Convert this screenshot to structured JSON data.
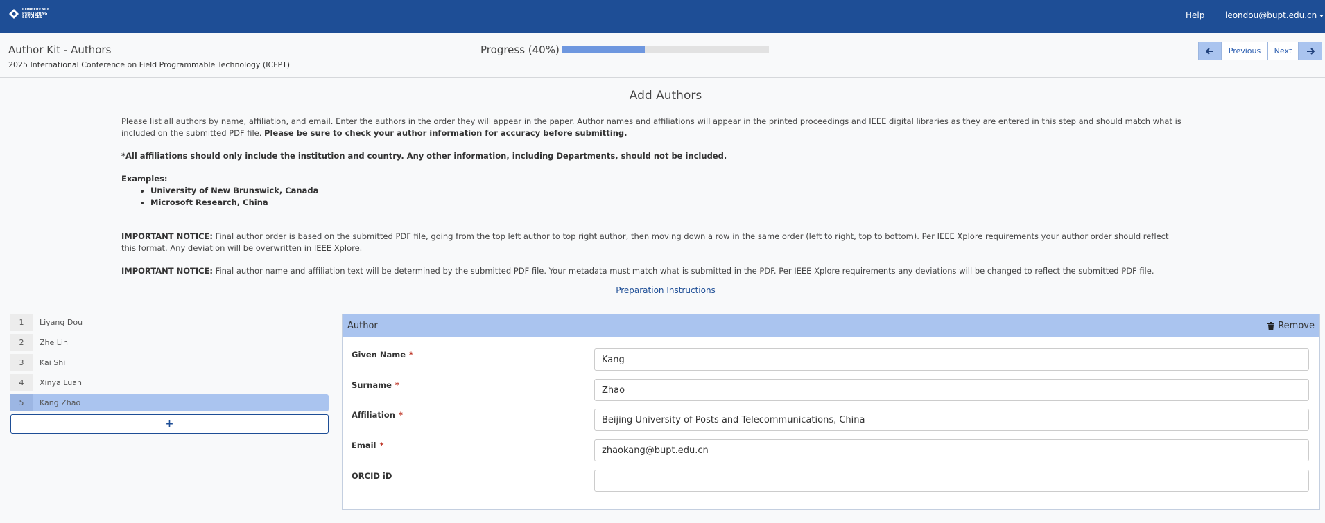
{
  "navbar": {
    "logo_lines": [
      "CONFERENCE",
      "PUBLISHING",
      "SERVICES"
    ],
    "help_label": "Help",
    "user_label": "leondou@bupt.edu.cn",
    "bg_color": "#1e4e96"
  },
  "subheader": {
    "kit_title": "Author Kit - Authors",
    "conference_name": "2025 International Conference on Field Programmable Technology (ICFPT)",
    "progress_label": "Progress (40%)",
    "progress_fraction": 0.4,
    "prev_label": "Previous",
    "next_label": "Next",
    "prev_icon": "arrow-left-icon",
    "next_icon": "arrow-right-icon"
  },
  "main": {
    "title": "Add Authors",
    "intro_text": "Please list all authors by name, affiliation, and email. Enter the authors in the order they will appear in the paper. Author names and affiliations will appear in the printed proceedings and IEEE digital libraries as they are entered in this step and should match what is included on the submitted PDF file.",
    "intro_bold": "Please be sure to check your author information for accuracy before submitting.",
    "affiliation_note": "*All affiliations should only include the institution and country. Any other information, including Departments, should not be included.",
    "examples_label": "Examples:",
    "examples": [
      "University of New Brunswick, Canada",
      "Microsoft Research, China"
    ],
    "notice_label": "IMPORTANT NOTICE:",
    "notice1_text": "Final author order is based on the submitted PDF file, going from the top left author to top right author, then moving down a row in the same order (left to right, top to bottom). Per IEEE Xplore requirements your author order should reflect this format. Any deviation will be overwritten in IEEE Xplore.",
    "notice2_text": "Final author name and affiliation text will be determined by the submitted PDF file. Your metadata must match what is submitted in the PDF. Per IEEE Xplore requirements any deviations will be changed to reflect the submitted PDF file.",
    "prep_link": "Preparation Instructions"
  },
  "authors": [
    {
      "num": "1",
      "name": "Liyang Dou"
    },
    {
      "num": "2",
      "name": "Zhe Lin"
    },
    {
      "num": "3",
      "name": "Kai Shi"
    },
    {
      "num": "4",
      "name": "Xinya Luan"
    },
    {
      "num": "5",
      "name": "Kang Zhao"
    }
  ],
  "add_author_label": "+",
  "card": {
    "header": "Author",
    "remove_label": "Remove",
    "fields": {
      "given_name": {
        "label": "Given Name",
        "value": "Kang",
        "required": true
      },
      "surname": {
        "label": "Surname",
        "value": "Zhao",
        "required": true
      },
      "affiliation": {
        "label": "Affiliation",
        "value": "Beijing University of Posts and Telecommunications, China",
        "required": true
      },
      "email": {
        "label": "Email",
        "value": "zhaokang@bupt.edu.cn",
        "required": true
      },
      "orcid": {
        "label": "ORCID iD",
        "value": "",
        "required": false
      }
    },
    "required_marker": "*"
  }
}
